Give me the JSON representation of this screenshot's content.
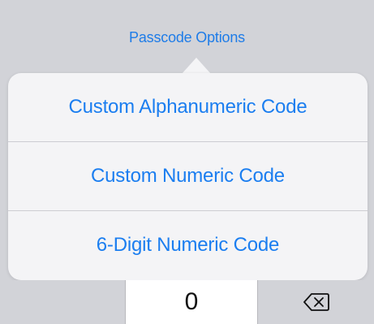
{
  "header": {
    "options_label": "Passcode Options"
  },
  "popover": {
    "items": [
      {
        "label": "Custom Alphanumeric Code"
      },
      {
        "label": "Custom Numeric Code"
      },
      {
        "label": "6-Digit Numeric Code"
      }
    ]
  },
  "keypad": {
    "zero_label": "0",
    "delete_icon": "delete-backspace-icon"
  },
  "colors": {
    "accent": "#1b7ef0",
    "background": "#d2d3d8",
    "popover_bg": "#f4f4f6"
  }
}
